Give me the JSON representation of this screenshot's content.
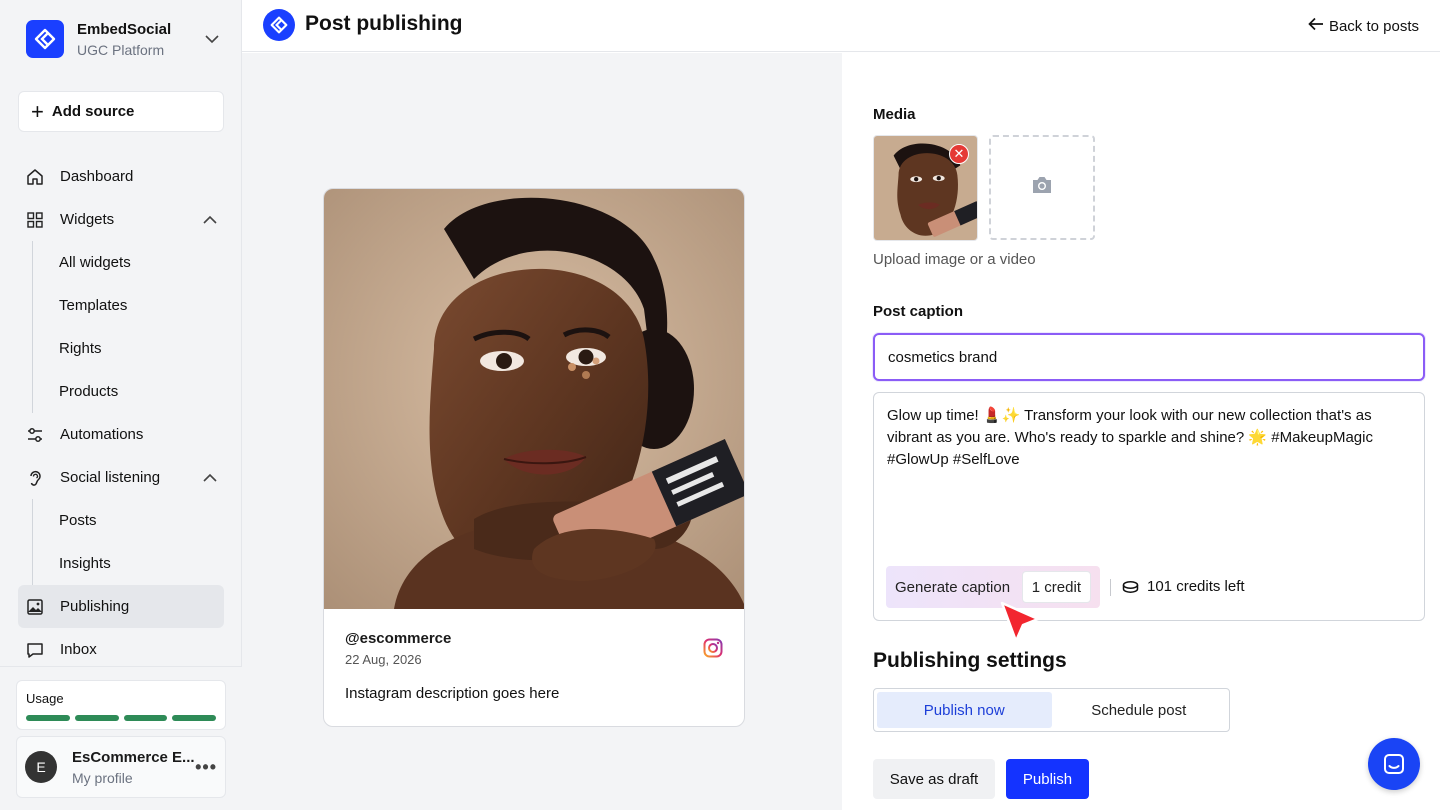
{
  "brand": {
    "name": "EmbedSocial",
    "subtitle": "UGC Platform"
  },
  "sidebar": {
    "add_source": "Add source",
    "items": [
      {
        "label": "Dashboard",
        "icon": "home-icon"
      },
      {
        "label": "Widgets",
        "icon": "grid-icon",
        "expanded": true,
        "children": [
          "All widgets",
          "Templates",
          "Rights",
          "Products"
        ]
      },
      {
        "label": "Automations",
        "icon": "sliders-icon"
      },
      {
        "label": "Social listening",
        "icon": "ear-icon",
        "expanded": true,
        "children": [
          "Posts",
          "Insights"
        ]
      },
      {
        "label": "Publishing",
        "icon": "image-icon",
        "active": true
      },
      {
        "label": "Inbox",
        "icon": "chat-icon"
      }
    ],
    "usage": {
      "label": "Usage",
      "bar_color": "#2e8b57"
    },
    "profile": {
      "initial": "E",
      "name": "EsCommerce E...",
      "subtitle": "My profile"
    }
  },
  "header": {
    "title": "Post publishing",
    "back_label": "Back to posts"
  },
  "preview": {
    "handle": "@escommerce",
    "date": "22 Aug, 2026",
    "description": "Instagram description goes here",
    "network_icon": "instagram-icon"
  },
  "form": {
    "media_label": "Media",
    "upload_hint": "Upload image or a video",
    "caption_label": "Post caption",
    "caption_input_value": "cosmetics brand",
    "caption_text": "Glow up time! 💄✨ Transform your look with our new collection that's as vibrant as you are. Who's ready to sparkle and shine? 🌟 #MakeupMagic #GlowUp #SelfLove",
    "generate_label": "Generate caption",
    "credit_cost": "1 credit",
    "credits_left": "101 credits left",
    "publishing_title": "Publishing settings",
    "publish_now": "Publish now",
    "schedule_post": "Schedule post",
    "save_draft": "Save as draft",
    "publish": "Publish"
  },
  "colors": {
    "accent": "#1433ff",
    "focus": "#8b5cf6"
  }
}
